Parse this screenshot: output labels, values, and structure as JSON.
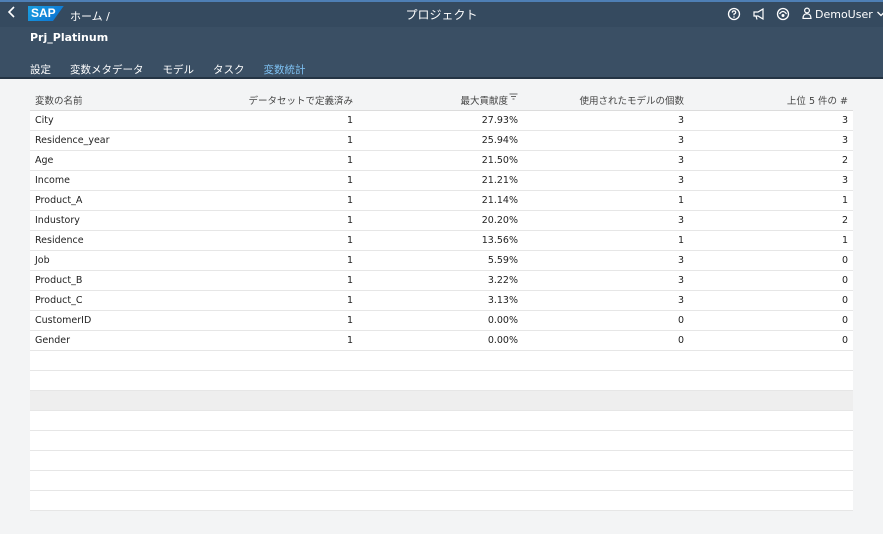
{
  "shell": {
    "home_label": "ホーム /",
    "logo_text": "SAP",
    "title": "プロジェクト",
    "user_name": "DemoUser"
  },
  "project": {
    "name": "Prj_Platinum"
  },
  "tabs": [
    {
      "label": "設定",
      "active": false
    },
    {
      "label": "変数メタデータ",
      "active": false
    },
    {
      "label": "モデル",
      "active": false
    },
    {
      "label": "タスク",
      "active": false
    },
    {
      "label": "変数統計",
      "active": true
    }
  ],
  "table": {
    "columns": [
      "変数の名前",
      "データセットで定義済み",
      "最大貢献度",
      "使用されたモデルの個数",
      "上位 5 件の #"
    ],
    "rows": [
      [
        "City",
        "1",
        "27.93%",
        "3",
        "3"
      ],
      [
        "Residence_year",
        "1",
        "25.94%",
        "3",
        "3"
      ],
      [
        "Age",
        "1",
        "21.50%",
        "3",
        "2"
      ],
      [
        "Income",
        "1",
        "21.21%",
        "3",
        "3"
      ],
      [
        "Product_A",
        "1",
        "21.14%",
        "1",
        "1"
      ],
      [
        "Industory",
        "1",
        "20.20%",
        "3",
        "2"
      ],
      [
        "Residence",
        "1",
        "13.56%",
        "1",
        "1"
      ],
      [
        "Job",
        "1",
        "5.59%",
        "3",
        "0"
      ],
      [
        "Product_B",
        "1",
        "3.22%",
        "3",
        "0"
      ],
      [
        "Product_C",
        "1",
        "3.13%",
        "3",
        "0"
      ],
      [
        "CustomerID",
        "1",
        "0.00%",
        "0",
        "0"
      ],
      [
        "Gender",
        "1",
        "0.00%",
        "0",
        "0"
      ]
    ]
  },
  "colors": {
    "shell_bg": "#354a5f",
    "header_bg": "#3a4f64",
    "active_tab": "#7fc3f5",
    "page_bg": "#f3f4f5"
  },
  "icons": {
    "back": "chevron-left-icon",
    "help": "help-icon",
    "notifications": "megaphone-icon",
    "copilot": "copilot-icon",
    "user": "person-icon",
    "user_menu": "chevron-down-icon",
    "sort": "sort-descending-icon"
  }
}
